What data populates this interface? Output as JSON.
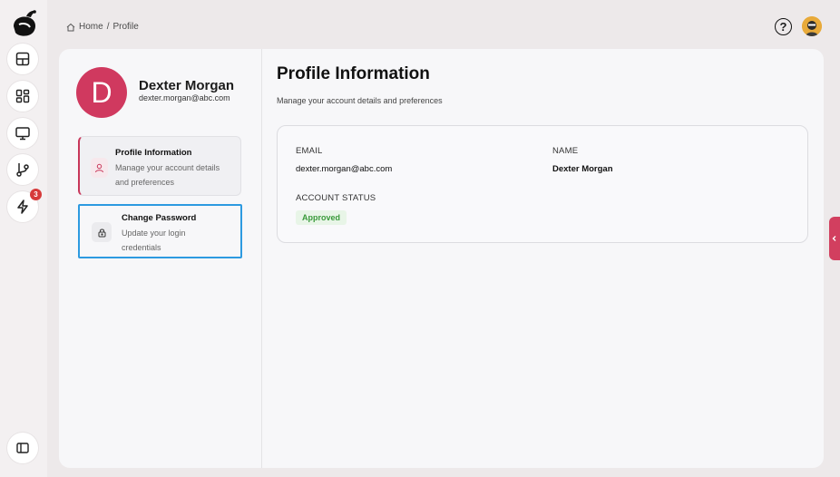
{
  "breadcrumb": {
    "home": "Home",
    "separator": "/",
    "current": "Profile"
  },
  "sidebar": {
    "icons": [
      "app-logo-icon",
      "table-icon",
      "dashboard-icon",
      "monitor-icon",
      "git-branch-icon",
      "lightning-icon",
      "panel-toggle-icon"
    ],
    "notification_badge": "3"
  },
  "header": {
    "help_icon": "help-circle-icon",
    "help_glyph": "?"
  },
  "profile": {
    "initial": "D",
    "name": "Dexter Morgan",
    "email": "dexter.morgan@abc.com",
    "avatar_color": "#d0395f"
  },
  "nav": [
    {
      "title": "Profile Information",
      "description": "Manage your account details and preferences",
      "icon": "user-icon",
      "active": true
    },
    {
      "title": "Change Password",
      "description": "Update your login credentials",
      "icon": "lock-icon",
      "active": false
    }
  ],
  "main": {
    "title": "Profile Information",
    "subtitle": "Manage your account details and preferences",
    "fields": {
      "email_label": "EMAIL",
      "email_value": "dexter.morgan@abc.com",
      "name_label": "NAME",
      "name_value": "Dexter Morgan",
      "status_label": "ACCOUNT STATUS",
      "status_value": "Approved"
    }
  },
  "colors": {
    "accent": "#d0395f",
    "focus": "#2d9ae0",
    "status_green": "#3a9a3b"
  }
}
